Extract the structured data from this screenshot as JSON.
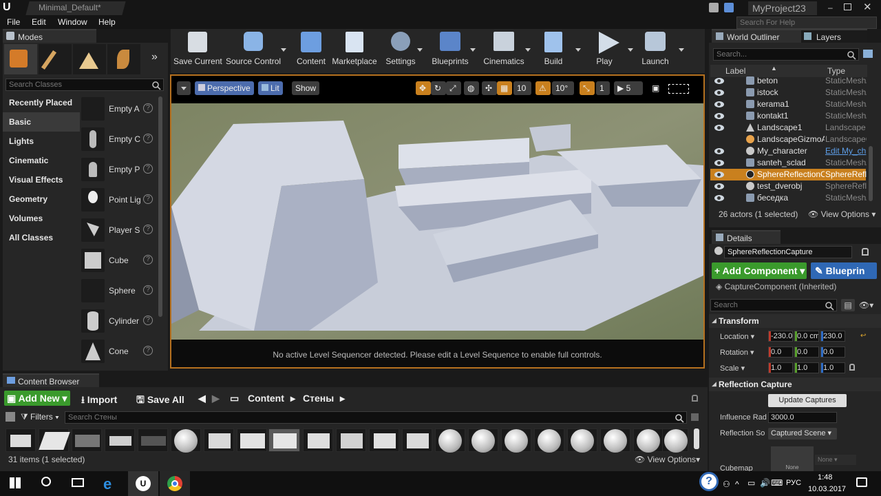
{
  "window": {
    "tab_title": "Minimal_Default*",
    "project_name": "MyProject23",
    "search_help_placeholder": "Search For Help"
  },
  "menu": [
    "File",
    "Edit",
    "Window",
    "Help"
  ],
  "modes": {
    "tab_label": "Modes",
    "search_placeholder": "Search Classes",
    "categories": [
      "Recently Placed",
      "Basic",
      "Lights",
      "Cinematic",
      "Visual Effects",
      "Geometry",
      "Volumes",
      "All Classes"
    ],
    "selected_category": "Basic",
    "items": [
      "Empty A",
      "Empty C",
      "Empty P",
      "Point Lig",
      "Player S",
      "Cube",
      "Sphere",
      "Cylinder",
      "Cone"
    ]
  },
  "toolbar": [
    "Save Current",
    "Source Control",
    "Content",
    "Marketplace",
    "Settings",
    "Blueprints",
    "Cinematics",
    "Build",
    "Play",
    "Launch"
  ],
  "viewport": {
    "perspective": "Perspective",
    "lit": "Lit",
    "show": "Show",
    "grid_snap": "10",
    "rot_snap": "10°",
    "scale_snap": "1",
    "camera_speed": "5",
    "message": "No active Level Sequencer detected. Please edit a Level Sequence to enable full controls."
  },
  "outliner": {
    "tab_label": "World Outliner",
    "layers_tab": "Layers",
    "search_placeholder": "Search...",
    "col_label": "Label",
    "col_type": "Type",
    "rows": [
      {
        "name": "beton",
        "type": "StaticMesh/"
      },
      {
        "name": "istock",
        "type": "StaticMesh/"
      },
      {
        "name": "kerama1",
        "type": "StaticMesh/"
      },
      {
        "name": "kontakt1",
        "type": "StaticMesh/"
      },
      {
        "name": "Landscape1",
        "type": "Landscape"
      },
      {
        "name": "LandscapeGizmoAc",
        "type": "LandscapeG"
      },
      {
        "name": "My_character",
        "type": "Edit My_ch"
      },
      {
        "name": "santeh_sclad",
        "type": "StaticMesh/"
      },
      {
        "name": "SphereReflectionCa",
        "type": "SphereRefle"
      },
      {
        "name": "test_dverobj",
        "type": "SphereRefle"
      },
      {
        "name": "беседка",
        "type": "StaticMesh/"
      }
    ],
    "selected_row": "SphereReflectionCa",
    "status": "26 actors (1 selected)",
    "view_options": "View Options"
  },
  "details": {
    "tab_label": "Details",
    "actor_name": "SphereReflectionCapture",
    "add_component": "+ Add Component",
    "blueprint": "Blueprin",
    "component_row": "CaptureComponent (Inherited)",
    "search_placeholder": "Search",
    "transform": {
      "header": "Transform",
      "location_label": "Location",
      "location": [
        "-230.0",
        "0.0 cm",
        "230.0"
      ],
      "rotation_label": "Rotation",
      "rotation": [
        "0.0",
        "0.0",
        "0.0"
      ],
      "scale_label": "Scale",
      "scale": [
        "1.0",
        "1.0",
        "1.0"
      ]
    },
    "reflection": {
      "header": "Reflection Capture",
      "update_button": "Update Captures",
      "influence_label": "Influence Rad",
      "influence_value": "3000.0",
      "source_label": "Reflection So",
      "source_value": "Captured Scene",
      "cubemap_label": "Cubemap",
      "cubemap_thumb": "None",
      "cubemap_dropdown": "None"
    }
  },
  "content_browser": {
    "tab_label": "Content Browser",
    "add_new": "Add New",
    "import": "Import",
    "save_all": "Save All",
    "path": [
      "Content",
      "Стены"
    ],
    "filters": "Filters",
    "search_placeholder": "Search Стены",
    "status": "31 items (1 selected)",
    "view_options": "View Options"
  },
  "taskbar": {
    "lang": "РУС",
    "time": "1:48",
    "date": "10.03.2017",
    "help": "?"
  },
  "colors": {
    "accent_green": "#3a9a2c",
    "accent_blue": "#2f68b5",
    "selection_orange": "#c9801e",
    "viewport_bg": "#000000"
  }
}
